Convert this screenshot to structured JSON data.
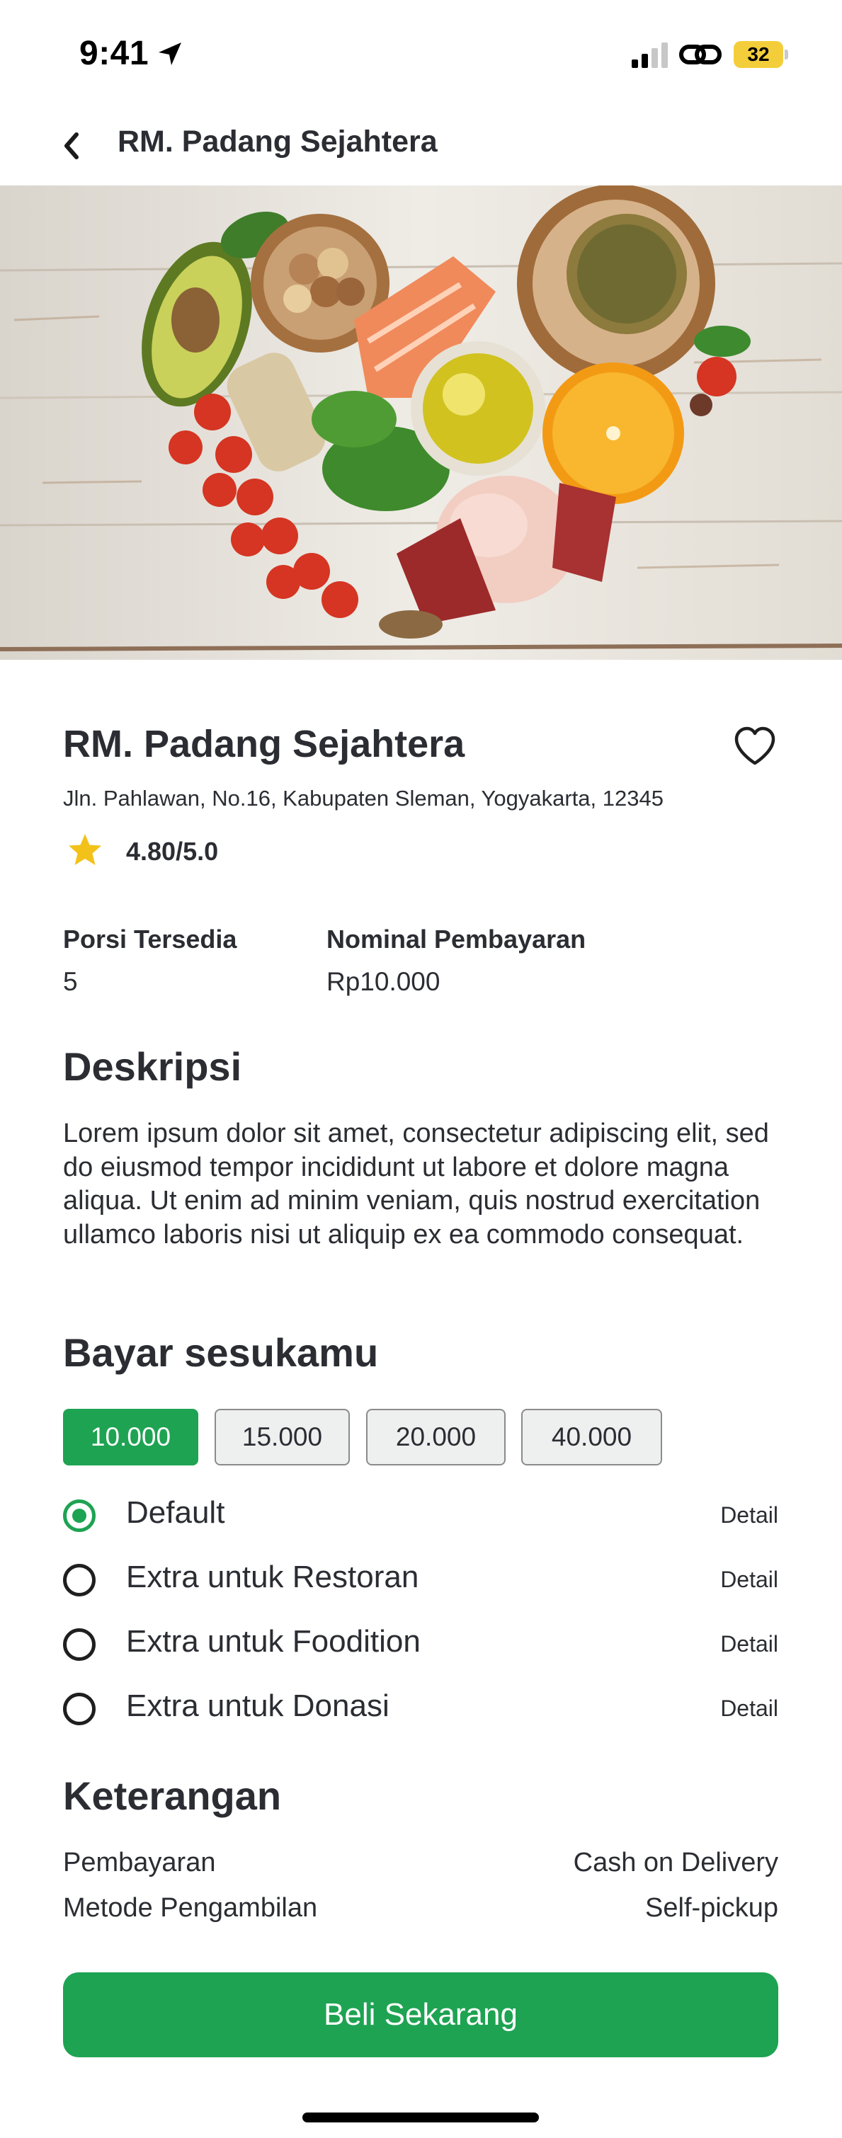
{
  "status_bar": {
    "time": "9:41",
    "battery": "32",
    "icons": [
      "location-arrow-icon",
      "cellular-signal-icon",
      "personal-hotspot-link-icon",
      "battery-icon"
    ]
  },
  "header": {
    "title": "RM. Padang Sejahtera",
    "back_icon": "chevron-left-icon"
  },
  "hero_image": {
    "description_icon": "healthy-food-photo"
  },
  "restaurant": {
    "name": "RM. Padang Sejahtera",
    "address": "Jln. Pahlawan, No.16, Kabupaten Sleman, Yogyakarta, 12345",
    "rating": "4.80/5.0",
    "favorite_icon": "heart-outline-icon",
    "rating_icon": "star-icon"
  },
  "info": {
    "portion_label": "Porsi Tersedia",
    "portion_value": "5",
    "payment_label": "Nominal Pembayaran",
    "payment_value": "Rp10.000"
  },
  "description": {
    "title": "Deskripsi",
    "text": "Lorem ipsum dolor sit amet, consectetur adipiscing elit, sed do eiusmod tempor incididunt ut labore et dolore magna aliqua. Ut enim ad minim veniam, quis nostrud exercitation ullamco laboris nisi ut aliquip ex ea commodo consequat."
  },
  "pay": {
    "title": "Bayar sesukamu",
    "amounts": [
      "10.000",
      "15.000",
      "20.000",
      "40.000"
    ],
    "selected_amount": "10.000",
    "options": [
      {
        "label": "Default",
        "detail": "Detail",
        "selected": true
      },
      {
        "label": "Extra untuk Restoran",
        "detail": "Detail",
        "selected": false
      },
      {
        "label": "Extra untuk Foodition",
        "detail": "Detail",
        "selected": false
      },
      {
        "label": "Extra untuk Donasi",
        "detail": "Detail",
        "selected": false
      }
    ]
  },
  "keterangan": {
    "title": "Keterangan",
    "rows": [
      {
        "label": "Pembayaran",
        "value": "Cash on Delivery"
      },
      {
        "label": "Metode Pengambilan",
        "value": "Self-pickup"
      }
    ]
  },
  "cta": {
    "label": "Beli Sekarang"
  },
  "colors": {
    "primary_green": "#1ea352",
    "text_dark": "#2b2d33",
    "star_yellow": "#f2c21b",
    "battery_yellow": "#f4ce3a"
  }
}
